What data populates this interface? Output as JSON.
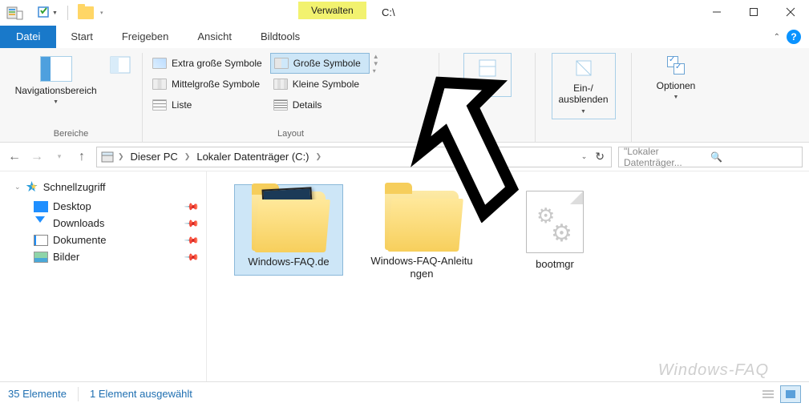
{
  "title": "C:\\",
  "contextual_tab": "Verwalten",
  "tabs": {
    "file": "Datei",
    "start": "Start",
    "share": "Freigeben",
    "view": "Ansicht",
    "tools": "Bildtools"
  },
  "ribbon": {
    "panes_group": "Bereiche",
    "nav_pane": "Navigationsbereich",
    "layout_group": "Layout",
    "layouts": {
      "xl": "Extra große Symbole",
      "large": "Große Symbole",
      "medium": "Mittelgroße Symbole",
      "small": "Kleine Symbole",
      "list": "Liste",
      "details": "Details"
    },
    "showhide": "Ein-/\nausblenden",
    "options": "Optionen"
  },
  "breadcrumb": {
    "this_pc": "Dieser PC",
    "drive": "Lokaler Datenträger (C:)"
  },
  "search_placeholder": "\"Lokaler Datenträger...",
  "sidebar": {
    "quick": "Schnellzugriff",
    "desktop": "Desktop",
    "downloads": "Downloads",
    "documents": "Dokumente",
    "pictures": "Bilder"
  },
  "items": {
    "faq": "Windows-FAQ.de",
    "anleitungen": "Windows-FAQ-Anleitungen",
    "bootmgr": "bootmgr"
  },
  "status": {
    "count": "35 Elemente",
    "selected": "1 Element ausgewählt"
  },
  "watermark": "Windows-FAQ"
}
